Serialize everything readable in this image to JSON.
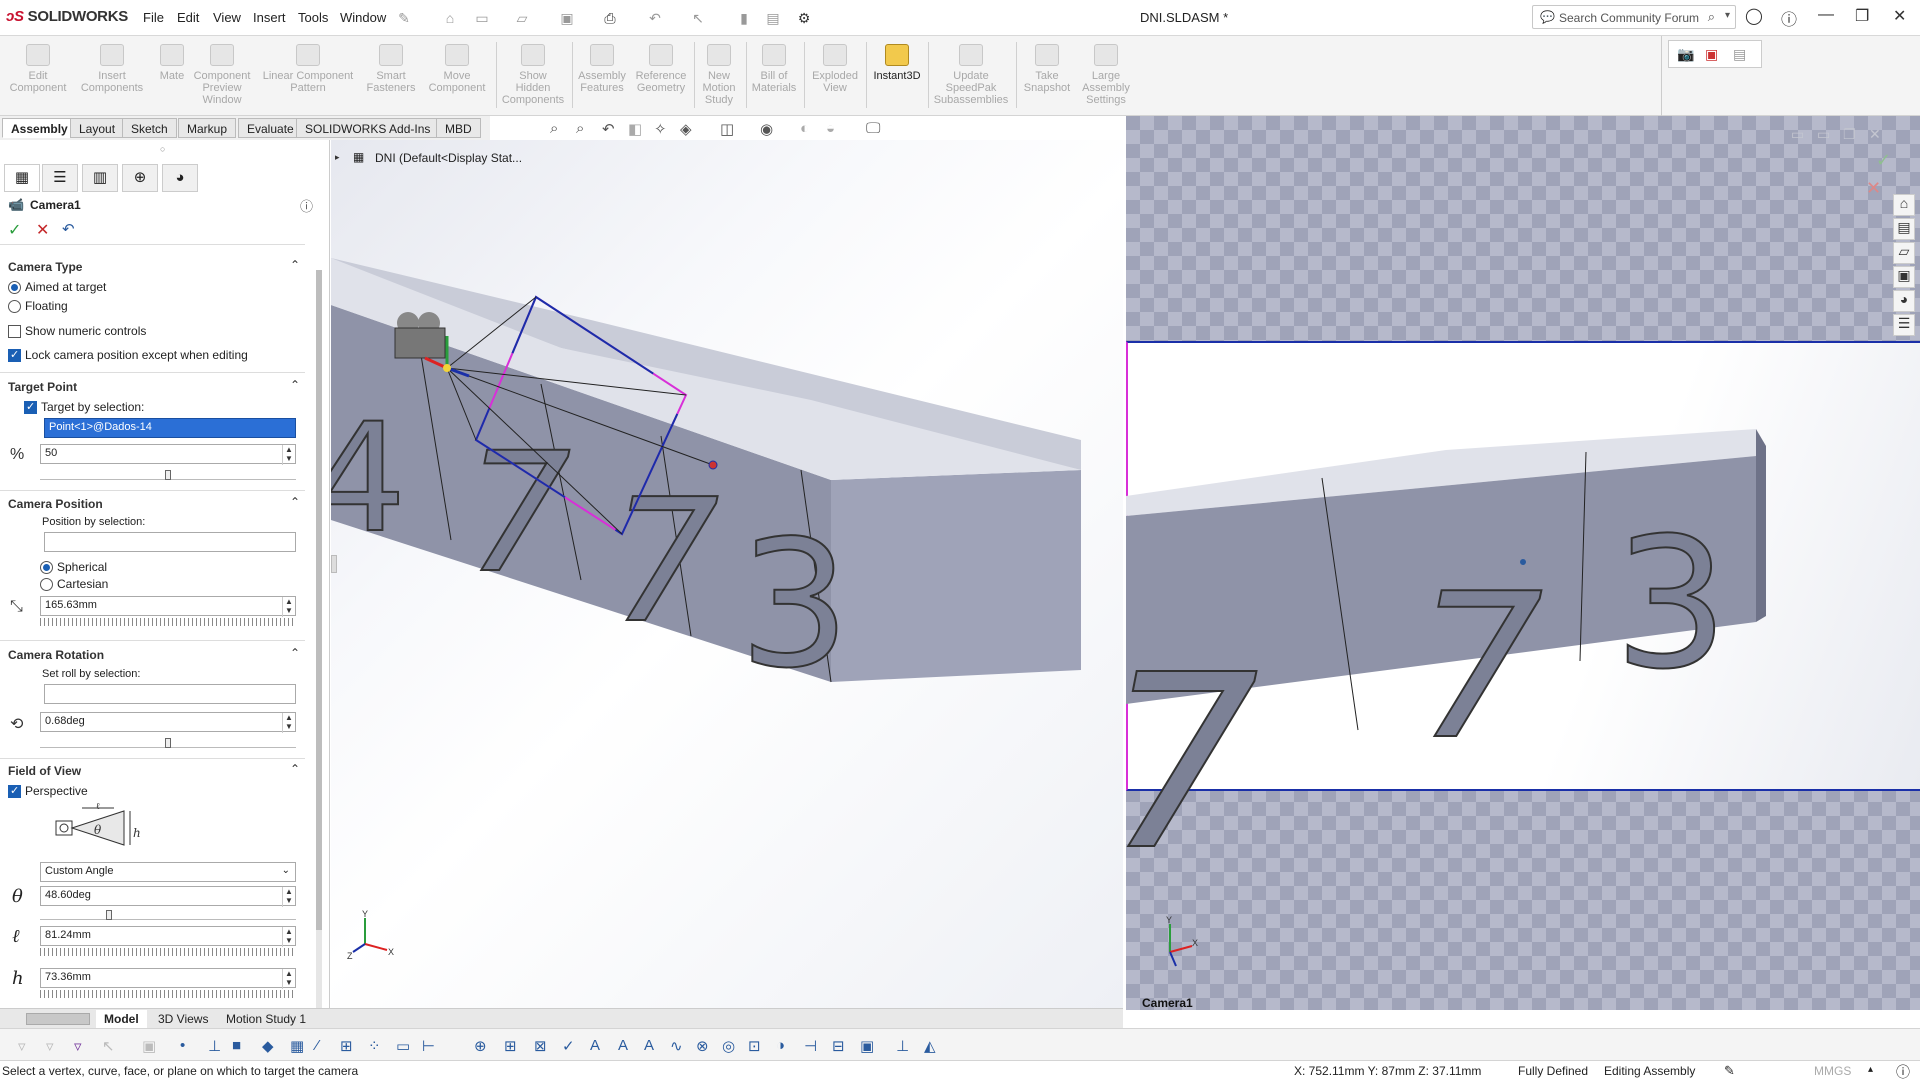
{
  "app": {
    "logo": "SOLIDWORKS",
    "doc_title": "DNI.SLDASM *"
  },
  "menu": [
    "File",
    "Edit",
    "View",
    "Insert",
    "Tools",
    "Window"
  ],
  "search": {
    "placeholder": "Search Community Forum"
  },
  "commands": [
    {
      "label": "Edit\nComponent",
      "icon": "edit-component-icon",
      "enabled": false
    },
    {
      "label": "Insert\nComponents",
      "icon": "insert-components-icon",
      "enabled": false
    },
    {
      "label": "Mate",
      "icon": "mate-icon",
      "enabled": false
    },
    {
      "label": "Component\nPreview\nWindow",
      "icon": "component-preview-icon",
      "enabled": false
    },
    {
      "label": "Linear Component\nPattern",
      "icon": "linear-pattern-icon",
      "enabled": false
    },
    {
      "label": "Smart\nFasteners",
      "icon": "smart-fasteners-icon",
      "enabled": false
    },
    {
      "label": "Move\nComponent",
      "icon": "move-component-icon",
      "enabled": false
    },
    {
      "label": "Show\nHidden\nComponents",
      "icon": "show-hidden-icon",
      "enabled": false
    },
    {
      "label": "Assembly\nFeatures",
      "icon": "assembly-features-icon",
      "enabled": false
    },
    {
      "label": "Reference\nGeometry",
      "icon": "reference-geometry-icon",
      "enabled": false
    },
    {
      "label": "New\nMotion\nStudy",
      "icon": "motion-study-icon",
      "enabled": false
    },
    {
      "label": "Bill of\nMaterials",
      "icon": "bom-icon",
      "enabled": false
    },
    {
      "label": "Exploded\nView",
      "icon": "exploded-view-icon",
      "enabled": false
    },
    {
      "label": "Instant3D",
      "icon": "instant3d-icon",
      "enabled": true
    },
    {
      "label": "Update\nSpeedPak\nSubassemblies",
      "icon": "speedpak-icon",
      "enabled": false
    },
    {
      "label": "Take\nSnapshot",
      "icon": "snapshot-icon",
      "enabled": false
    },
    {
      "label": "Large\nAssembly\nSettings",
      "icon": "large-assembly-icon",
      "enabled": false
    }
  ],
  "tabs": [
    "Assembly",
    "Layout",
    "Sketch",
    "Markup",
    "Evaluate",
    "SOLIDWORKS Add-Ins",
    "MBD"
  ],
  "tree": {
    "root": "DNI  (Default<Display Stat..."
  },
  "property": {
    "title": "Camera1",
    "camera_type": {
      "header": "Camera Type",
      "aimed": "Aimed at target",
      "floating": "Floating",
      "show_numeric": "Show numeric controls",
      "lock": "Lock camera position except when editing"
    },
    "target_point": {
      "header": "Target Point",
      "by_selection": "Target by selection:",
      "selection_value": "Point<1>@Dados-14",
      "distance": "50",
      "distance_level": 0.5
    },
    "camera_position": {
      "header": "Camera Position",
      "by_selection": "Position by selection:",
      "spherical": "Spherical",
      "cartesian": "Cartesian",
      "distance": "165.63mm"
    },
    "camera_rotation": {
      "header": "Camera Rotation",
      "roll_by_selection": "Set roll by selection:",
      "roll": "0.68deg",
      "roll_level": 0.5
    },
    "field_of_view": {
      "header": "Field of View",
      "perspective": "Perspective",
      "preset": "Custom Angle",
      "theta": "48.60deg",
      "theta_level": 0.27,
      "l": "81.24mm",
      "h": "73.36mm"
    }
  },
  "viewport": {
    "digits": [
      "4",
      "7",
      "7",
      "3"
    ],
    "preview_digits": [
      "7",
      "7",
      "3"
    ],
    "camera_label": "Camera1"
  },
  "bottom_tabs": [
    "Model",
    "3D Views",
    "Motion Study 1"
  ],
  "status": {
    "hint": "Select a vertex, curve, face, or plane on which to target the camera",
    "coords": "X: 752.11mm Y: 87mm Z: 37.11mm",
    "state": "Fully Defined",
    "mode": "Editing Assembly",
    "units": "MMGS"
  }
}
